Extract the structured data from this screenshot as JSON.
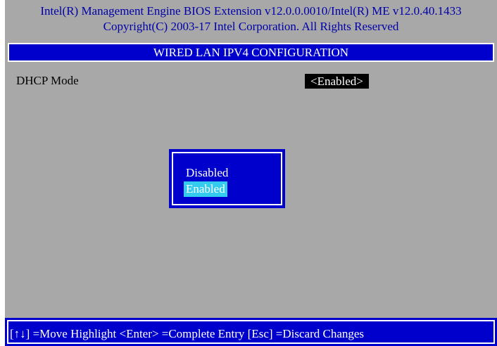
{
  "header": {
    "line1": "Intel(R) Management Engine BIOS Extension v12.0.0.0010/Intel(R) ME v12.0.40.1433",
    "line2": "Copyright(C) 2003-17 Intel Corporation. All Rights Reserved"
  },
  "title": "WIRED LAN IPV4 CONFIGURATION",
  "settings": [
    {
      "label": "DHCP Mode",
      "value": "<Enabled>"
    }
  ],
  "popup": {
    "options": [
      "Disabled",
      "Enabled"
    ],
    "selected_index": 1
  },
  "footer": {
    "help_text": "[↑↓] =Move Highlight   <Enter> =Complete Entry   [Esc] =Discard Changes"
  },
  "colors": {
    "background": "#a8a8a8",
    "panel_blue": "#0000cc",
    "header_text": "#0000a8",
    "highlight": "#33ccee"
  }
}
